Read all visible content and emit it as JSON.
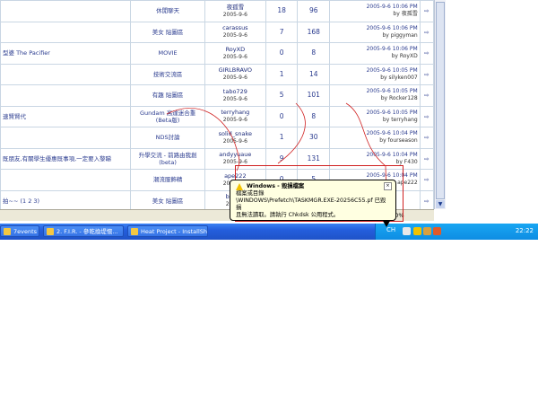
{
  "forum": {
    "rows": [
      {
        "topic": "",
        "board": "休閒聊天",
        "author": "夜孤雪",
        "author_date": "2005-9-6",
        "replies": "18",
        "views": "96",
        "last_time": "2005-9-6 10:06 PM",
        "last_by": "by 夜孤雪"
      },
      {
        "topic": "",
        "board": "美女 貼圖區",
        "author": "carassus",
        "author_date": "2005-9-6",
        "replies": "7",
        "views": "168",
        "last_time": "2005-9-6 10:06 PM",
        "last_by": "by piggyman"
      },
      {
        "topic": "型婆 The Pacifier",
        "board": "MOVIE",
        "author": "RoyXD",
        "author_date": "2005-9-6",
        "replies": "0",
        "views": "8",
        "last_time": "2005-9-6 10:06 PM",
        "last_by": "by RoyXD"
      },
      {
        "topic": "",
        "board": "技術交流區",
        "author": "GIRLBRAVO",
        "author_date": "2005-9-6",
        "replies": "1",
        "views": "14",
        "last_time": "2005-9-6 10:05 PM",
        "last_by": "by silyken007"
      },
      {
        "topic": "",
        "board": "有趣 貼圖區",
        "author": "tabo729",
        "author_date": "2005-9-6",
        "replies": "5",
        "views": "101",
        "last_time": "2005-9-6 10:05 PM",
        "last_by": "by Rocker128"
      },
      {
        "topic": "速賢賢代",
        "board": "Gundam 高達迷合重 (Beta版)",
        "author": "terryhang",
        "author_date": "2005-9-6",
        "replies": "0",
        "views": "8",
        "last_time": "2005-9-6 10:05 PM",
        "last_by": "by terryhang"
      },
      {
        "topic": "",
        "board": "NDS討論",
        "author": "solid_snake",
        "author_date": "2005-9-6",
        "replies": "1",
        "views": "30",
        "last_time": "2005-9-6 10:04 PM",
        "last_by": "by fourseason"
      },
      {
        "topic": "既朋友,有關學生優惠既事項,一定要入黎睇",
        "board": "升學交流 - 前路由我創 (beta)",
        "author": "andyyuaue",
        "author_date": "2005-9-6",
        "replies": "9",
        "views": "131",
        "last_time": "2005-9-6 10:04 PM",
        "last_by": "by F430"
      },
      {
        "topic": "",
        "board": "潮流服飾精",
        "author": "ape222",
        "author_date": "2005-9-6",
        "replies": "0",
        "views": "5",
        "last_time": "2005-9-6 10:04 PM",
        "last_by": "by ape222"
      },
      {
        "topic": "拍~~ (1 2 3)",
        "board": "美女 貼圖區",
        "author": "bugatt",
        "author_date": "2005-9",
        "replies": "",
        "views": "",
        "last_time": "",
        "last_by": ""
      }
    ]
  },
  "status": {
    "zoom": "100%"
  },
  "balloon": {
    "title": "Windows - 毀損檔案",
    "line1": "檔案或目錄",
    "line2": "\\WINDOWS\\Prefetch\\TASKMGR.EXE-20256C55.pf 已毀損",
    "line3": "且無法讀取。請執行 Chkdsk 公用程式。"
  },
  "taskbar": {
    "buttons": [
      "7events forn...",
      "2. F.I.R. - 參乾換堤懷...",
      "Heat Project - InstallSh..."
    ],
    "lang": "CH",
    "clock": "22:22"
  },
  "colors": {
    "taskbar_blue": "#245edc",
    "tray_blue": "#0e8de3",
    "balloon_bg": "#ffffe1",
    "annotation_red": "#d02020"
  }
}
